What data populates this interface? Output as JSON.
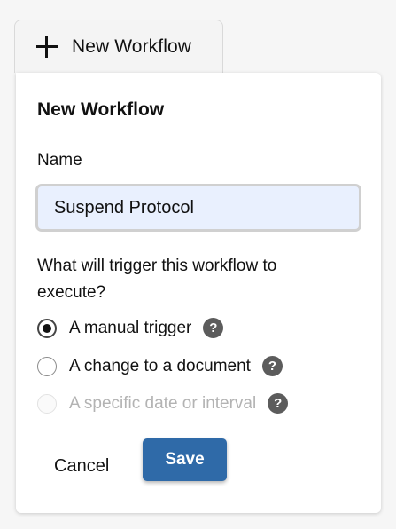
{
  "trigger": {
    "label": "New Workflow",
    "icon": "plus-icon"
  },
  "panel": {
    "title": "New Workflow",
    "name_label": "Name",
    "name_value": "Suspend Protocol",
    "question": "What will trigger this workflow to execute?",
    "options": [
      {
        "label": "A manual trigger",
        "checked": true,
        "disabled": false
      },
      {
        "label": "A change to a document",
        "checked": false,
        "disabled": false
      },
      {
        "label": "A specific date or interval",
        "checked": false,
        "disabled": true
      }
    ],
    "help_glyph": "?",
    "cancel_label": "Cancel",
    "save_label": "Save"
  },
  "colors": {
    "save_button": "#2f6aa8",
    "input_background": "#e9f0fe",
    "help_icon": "#5c5c5c",
    "disabled_text": "#b3b3b3"
  }
}
